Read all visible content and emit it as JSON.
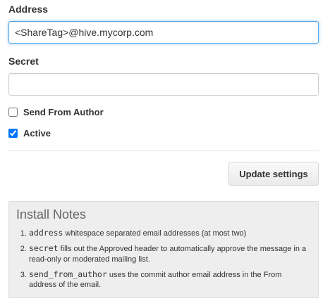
{
  "form": {
    "address": {
      "label": "Address",
      "value": "<ShareTag>@hive.mycorp.com"
    },
    "secret": {
      "label": "Secret",
      "value": ""
    },
    "send_from_author": {
      "label": "Send From Author",
      "checked": false
    },
    "active": {
      "label": "Active",
      "checked": true
    },
    "update_button": "Update settings"
  },
  "install_notes": {
    "title": "Install Notes",
    "items": [
      {
        "code": "address",
        "text": " whitespace separated email addresses (at most two)"
      },
      {
        "code": "secret",
        "text": " fills out the Approved header to automatically approve the message in a read-only or moderated mailing list."
      },
      {
        "code": "send_from_author",
        "text": " uses the commit author email address in the From address of the email."
      }
    ]
  },
  "colors": {
    "focus_border": "#51a7e8",
    "notes_background": "#eeeeee"
  }
}
